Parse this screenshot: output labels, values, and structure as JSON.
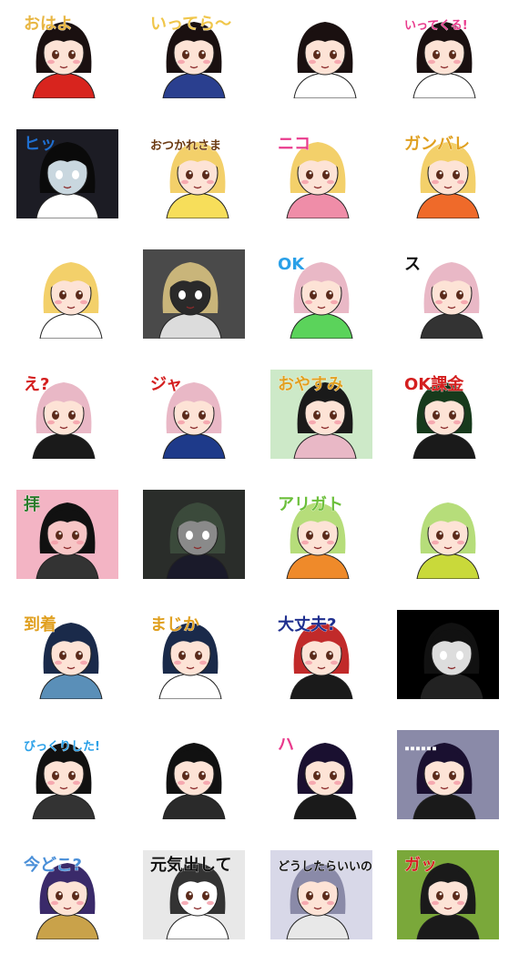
{
  "stickers": [
    {
      "id": "s1",
      "scene": "girl-morning-yawn",
      "bg": "#ffffff",
      "hair": "#1a1010",
      "skin": "#fde3d6",
      "shirt": "#d8241e",
      "text": "おはよ",
      "textColor": "#e8b642"
    },
    {
      "id": "s2",
      "scene": "girl-see-you",
      "bg": "#ffffff",
      "hair": "#1a1010",
      "skin": "#fde3d6",
      "shirt": "#2a3f8f",
      "text": "いってら〜",
      "textColor": "#f0c64a"
    },
    {
      "id": "s3",
      "scene": "girl-blush",
      "bg": "#ffffff",
      "hair": "#1a1010",
      "skin": "#fde3d6",
      "shirt": "#ffffff",
      "text": "",
      "textColor": "#000000"
    },
    {
      "id": "s4",
      "scene": "girl-going",
      "bg": "#ffffff",
      "hair": "#1a1010",
      "skin": "#fde3d6",
      "shirt": "#ffffff",
      "text": "いってくる!",
      "textColor": "#e93a8c"
    },
    {
      "id": "s5",
      "scene": "girl-shocked-dark",
      "bg": "#1c1c24",
      "hair": "#0a0a0a",
      "skin": "#c9d7df",
      "shirt": "#ffffff",
      "text": "ヒッ",
      "textColor": "#1f6fd0"
    },
    {
      "id": "s6",
      "scene": "blonde-otsukare",
      "bg": "#ffffff",
      "hair": "#f3d06a",
      "skin": "#fde3d6",
      "shirt": "#f7de5a",
      "text": "おつかれさま",
      "textColor": "#6b3a12"
    },
    {
      "id": "s7",
      "scene": "blonde-smile",
      "bg": "#ffffff",
      "hair": "#f3d06a",
      "skin": "#fde3d6",
      "shirt": "#ef8da8",
      "text": "ニコ",
      "textColor": "#e93a8c"
    },
    {
      "id": "s8",
      "scene": "blonde-cheer",
      "bg": "#ffffff",
      "hair": "#f3d06a",
      "skin": "#fde3d6",
      "shirt": "#ef6a2a",
      "text": "ガンバレ",
      "textColor": "#e0a020"
    },
    {
      "id": "s9",
      "scene": "blonde-closeup",
      "bg": "#ffffff",
      "hair": "#f3d06a",
      "skin": "#fde3d6",
      "shirt": "#ffffff",
      "text": "",
      "textColor": "#000000"
    },
    {
      "id": "s10",
      "scene": "blonde-gloomy",
      "bg": "#4a4a4a",
      "hair": "#c9b57a",
      "skin": "#2a2a2a",
      "shirt": "#dcdcdc",
      "text": "",
      "textColor": "#ffffff"
    },
    {
      "id": "s11",
      "scene": "pinkhair-ok",
      "bg": "#ffffff",
      "hair": "#e9b8c6",
      "skin": "#fde3d6",
      "shirt": "#5bd35b",
      "text": "OK",
      "textColor": "#2aa0e8"
    },
    {
      "id": "s12",
      "scene": "pinkhair-sleeping",
      "bg": "#ffffff",
      "hair": "#e9b8c6",
      "skin": "#fde3d6",
      "shirt": "#333333",
      "text": "ス",
      "textColor": "#111111"
    },
    {
      "id": "s13",
      "scene": "pinkhair-huh",
      "bg": "#ffffff",
      "hair": "#e9b8c6",
      "skin": "#fde3d6",
      "shirt": "#1a1a1a",
      "text": "え?",
      "textColor": "#d41f1f"
    },
    {
      "id": "s14",
      "scene": "pinkhair-jump",
      "bg": "#ffffff",
      "hair": "#e9b8c6",
      "skin": "#fde3d6",
      "shirt": "#1e3a8a",
      "text": "ジャ",
      "textColor": "#d41f1f"
    },
    {
      "id": "s15",
      "scene": "greenboy-goodnight",
      "bg": "#cde9c8",
      "hair": "#1a1a1a",
      "skin": "#fde3d6",
      "shirt": "#e9b8c6",
      "text": "おやすみ",
      "textColor": "#e0a020"
    },
    {
      "id": "s16",
      "scene": "greenboy-ok-kakin",
      "bg": "#ffffff",
      "hair": "#173a1c",
      "skin": "#fde3d6",
      "shirt": "#1a1a1a",
      "text": "OK課金",
      "textColor": "#d41f1f"
    },
    {
      "id": "s17",
      "scene": "greenboy-worship",
      "bg": "#f3b4c4",
      "hair": "#111111",
      "skin": "#f7c6c6",
      "shirt": "#333333",
      "text": "拝",
      "textColor": "#2a7a2a"
    },
    {
      "id": "s18",
      "scene": "greenboy-dark",
      "bg": "#2a2d2a",
      "hair": "#3b4a3b",
      "skin": "#8a8a8a",
      "shirt": "#1a1a2a",
      "text": "",
      "textColor": "#ffffff"
    },
    {
      "id": "s19",
      "scene": "greenhair-thanks",
      "bg": "#ffffff",
      "hair": "#b6dd7a",
      "skin": "#fde3d6",
      "shirt": "#ef8a2a",
      "text": "アリガト",
      "textColor": "#6bbf3a"
    },
    {
      "id": "s20",
      "scene": "greenhair-party",
      "bg": "#ffffff",
      "hair": "#b6dd7a",
      "skin": "#fde3d6",
      "shirt": "#c9d93a",
      "text": "",
      "textColor": "#f2c035"
    },
    {
      "id": "s21",
      "scene": "glasses-arrived",
      "bg": "#ffffff",
      "hair": "#1a2a4a",
      "skin": "#fde3d6",
      "shirt": "#5a8fb8",
      "text": "到着",
      "textColor": "#e0a020"
    },
    {
      "id": "s22",
      "scene": "glasses-seriously",
      "bg": "#ffffff",
      "hair": "#1a2a4a",
      "skin": "#fde3d6",
      "shirt": "#ffffff",
      "text": "まじか",
      "textColor": "#e0a020"
    },
    {
      "id": "s23",
      "scene": "redhair-daijoubu",
      "bg": "#ffffff",
      "hair": "#c12a2a",
      "skin": "#fde3d6",
      "shirt": "#1a1a1a",
      "text": "大丈夫?",
      "textColor": "#1f2f8f"
    },
    {
      "id": "s24",
      "scene": "duo-dark",
      "bg": "#000000",
      "hair": "#111111",
      "skin": "#dddddd",
      "shirt": "#222222",
      "text": "",
      "textColor": "#ffffff"
    },
    {
      "id": "s25",
      "scene": "blackhair-bikkuri",
      "bg": "#ffffff",
      "hair": "#111111",
      "skin": "#fde3d6",
      "shirt": "#333333",
      "text": "びっくりした!",
      "textColor": "#2aa0e8"
    },
    {
      "id": "s26",
      "scene": "blackhair-happy",
      "bg": "#ffffff",
      "hair": "#111111",
      "skin": "#fde3d6",
      "shirt": "#2a2a2a",
      "text": "",
      "textColor": "#e93a8c"
    },
    {
      "id": "s27",
      "scene": "purplehair-ha",
      "bg": "#ffffff",
      "hair": "#1a1030",
      "skin": "#fde3d6",
      "shirt": "#1a1a1a",
      "text": "ハ",
      "textColor": "#e93a8c"
    },
    {
      "id": "s28",
      "scene": "purplehair-serious",
      "bg": "#8a8aa8",
      "hair": "#1a1030",
      "skin": "#fde3d6",
      "shirt": "#1a1a1a",
      "text": "……",
      "textColor": "#ffffff"
    },
    {
      "id": "s29",
      "scene": "purplehair-where",
      "bg": "#ffffff",
      "hair": "#3a2a6a",
      "skin": "#fde3d6",
      "shirt": "#c9a24a",
      "text": "今どこ?",
      "textColor": "#4a8fd8"
    },
    {
      "id": "s30",
      "scene": "manga-genki",
      "bg": "#e8e8e8",
      "hair": "#333333",
      "skin": "#ffffff",
      "shirt": "#ffffff",
      "text": "元気出して",
      "textColor": "#111111"
    },
    {
      "id": "s31",
      "scene": "manga-doushitara",
      "bg": "#d8d8e8",
      "hair": "#8a8aa8",
      "skin": "#fde3d6",
      "shirt": "#e8e8e8",
      "text": "どうしたらいいのか…",
      "textColor": "#111111"
    },
    {
      "id": "s32",
      "scene": "duo-hug",
      "bg": "#7aa83a",
      "hair": "#1a1a1a",
      "skin": "#fde3d6",
      "shirt": "#1a1a1a",
      "text": "ガッ",
      "textColor": "#d41f1f"
    }
  ]
}
